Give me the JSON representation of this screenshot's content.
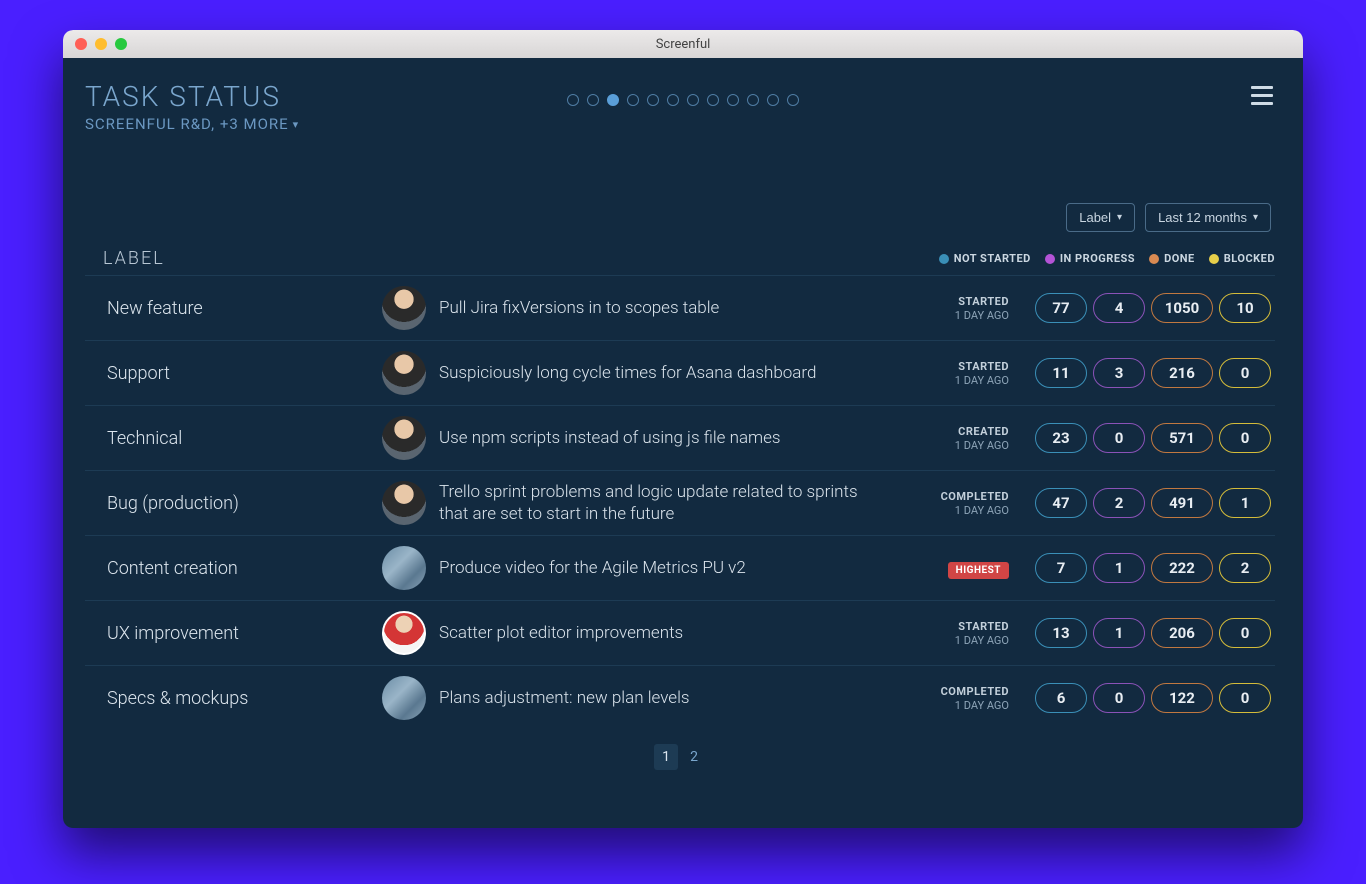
{
  "window": {
    "title": "Screenful"
  },
  "header": {
    "title": "TASK STATUS",
    "subtitle": "SCREENFUL R&D, +3 MORE"
  },
  "nav": {
    "dotCount": 12,
    "activeIndex": 2
  },
  "controls": {
    "labelBtn": "Label",
    "rangeBtn": "Last 12 months"
  },
  "columnHeader": "LABEL",
  "legend": {
    "notStarted": "NOT STARTED",
    "inProgress": "IN PROGRESS",
    "done": "DONE",
    "blocked": "BLOCKED"
  },
  "tasks": [
    {
      "label": "New feature",
      "avatar": "person1",
      "title": "Pull Jira fixVersions in to scopes table",
      "status": {
        "main": "STARTED",
        "sub": "1 DAY AGO"
      },
      "counts": {
        "ns": "77",
        "ip": "4",
        "dn": "1050",
        "bk": "10"
      }
    },
    {
      "label": "Support",
      "avatar": "person1",
      "title": "Suspiciously long cycle times for Asana dashboard",
      "status": {
        "main": "STARTED",
        "sub": "1 DAY AGO"
      },
      "counts": {
        "ns": "11",
        "ip": "3",
        "dn": "216",
        "bk": "0"
      }
    },
    {
      "label": "Technical",
      "avatar": "person1",
      "title": "Use npm scripts instead of using js file names",
      "status": {
        "main": "CREATED",
        "sub": "1 DAY AGO"
      },
      "counts": {
        "ns": "23",
        "ip": "0",
        "dn": "571",
        "bk": "0"
      }
    },
    {
      "label": "Bug (production)",
      "avatar": "person1",
      "title": "Trello sprint problems and logic update related to sprints that are set to start in the future",
      "status": {
        "main": "COMPLETED",
        "sub": "1 DAY AGO"
      },
      "counts": {
        "ns": "47",
        "ip": "2",
        "dn": "491",
        "bk": "1"
      }
    },
    {
      "label": "Content creation",
      "avatar": "abstract",
      "title": "Produce video for the Agile Metrics PU v2",
      "status": {
        "main": "HIGHEST",
        "sub": "",
        "highest": true
      },
      "counts": {
        "ns": "7",
        "ip": "1",
        "dn": "222",
        "bk": "2"
      }
    },
    {
      "label": "UX improvement",
      "avatar": "person2",
      "title": "Scatter plot editor improvements",
      "status": {
        "main": "STARTED",
        "sub": "1 DAY AGO"
      },
      "counts": {
        "ns": "13",
        "ip": "1",
        "dn": "206",
        "bk": "0"
      }
    },
    {
      "label": "Specs & mockups",
      "avatar": "abstract",
      "title": "Plans adjustment: new plan levels",
      "status": {
        "main": "COMPLETED",
        "sub": "1 DAY AGO"
      },
      "counts": {
        "ns": "6",
        "ip": "0",
        "dn": "122",
        "bk": "0"
      }
    }
  ],
  "pagination": {
    "pages": [
      "1",
      "2"
    ],
    "active": 0
  }
}
